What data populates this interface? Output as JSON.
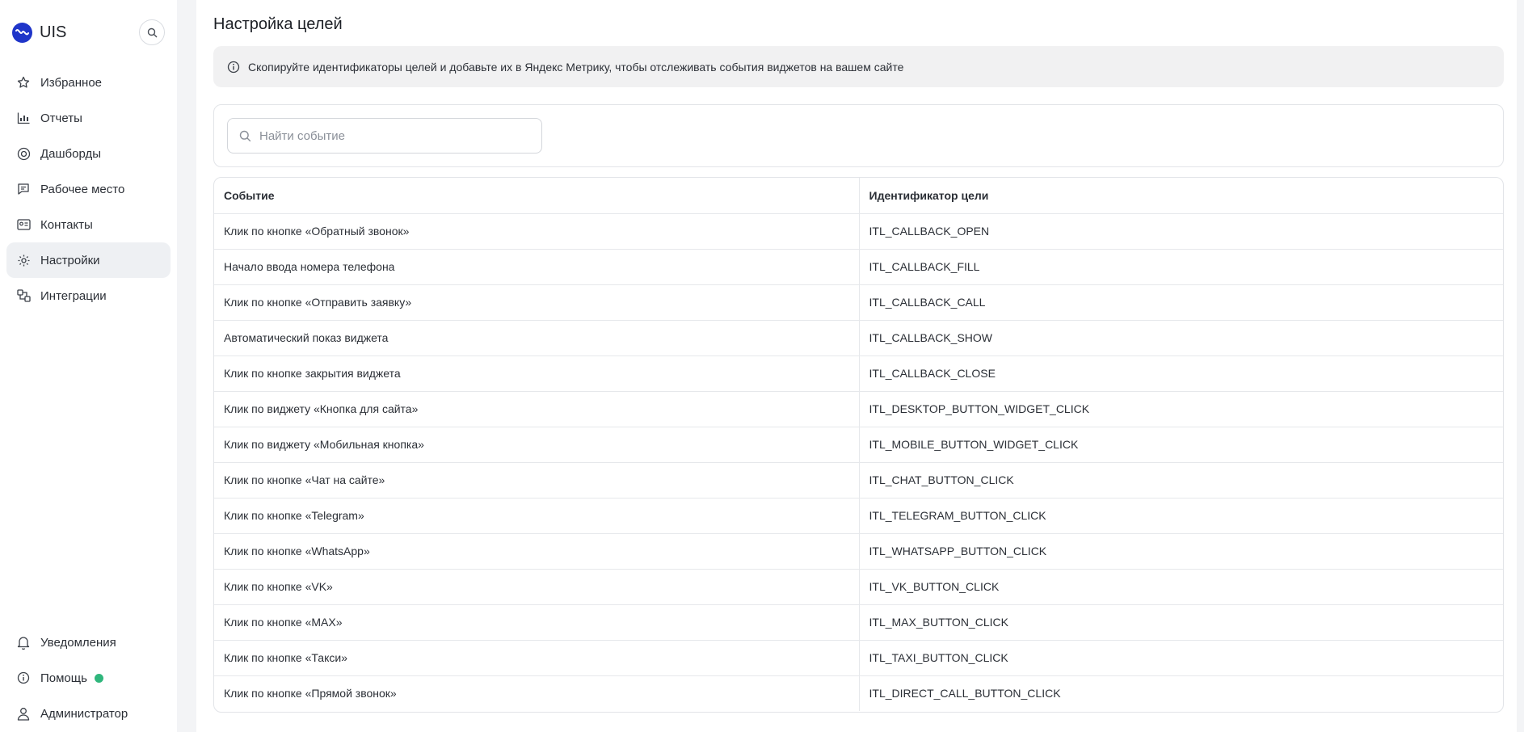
{
  "brand": {
    "name": "UIS"
  },
  "sidebar": {
    "items": [
      {
        "label": "Избранное",
        "icon": "star-icon"
      },
      {
        "label": "Отчеты",
        "icon": "chart-icon"
      },
      {
        "label": "Дашборды",
        "icon": "dashboard-icon"
      },
      {
        "label": "Рабочее место",
        "icon": "workplace-icon"
      },
      {
        "label": "Контакты",
        "icon": "contacts-icon"
      },
      {
        "label": "Настройки",
        "icon": "gear-icon",
        "active": true
      },
      {
        "label": "Интеграции",
        "icon": "integrations-icon"
      }
    ],
    "bottom": [
      {
        "label": "Уведомления",
        "icon": "bell-icon"
      },
      {
        "label": "Помощь",
        "icon": "info-icon",
        "status_color": "#2fb67c"
      },
      {
        "label": "Администратор",
        "icon": "user-icon"
      }
    ]
  },
  "page": {
    "title": "Настройка целей",
    "info": "Скопируйте идентификаторы целей и добавьте их в Яндекс Метрику, чтобы отслеживать события виджетов на вашем сайте"
  },
  "search": {
    "placeholder": "Найти событие",
    "value": ""
  },
  "table": {
    "headers": [
      "Событие",
      "Идентификатор цели"
    ],
    "rows": [
      [
        "Клик по кнопке «Обратный звонок»",
        "ITL_CALLBACK_OPEN"
      ],
      [
        "Начало ввода номера телефона",
        "ITL_CALLBACK_FILL"
      ],
      [
        "Клик по кнопке «Отправить заявку»",
        "ITL_CALLBACK_CALL"
      ],
      [
        "Автоматический показ виджета",
        "ITL_CALLBACK_SHOW"
      ],
      [
        "Клик по кнопке закрытия виджета",
        "ITL_CALLBACK_CLOSE"
      ],
      [
        "Клик по виджету «Кнопка для сайта»",
        "ITL_DESKTOP_BUTTON_WIDGET_CLICK"
      ],
      [
        "Клик по виджету «Мобильная кнопка»",
        "ITL_MOBILE_BUTTON_WIDGET_CLICK"
      ],
      [
        "Клик по кнопке «Чат на сайте»",
        "ITL_CHAT_BUTTON_CLICK"
      ],
      [
        "Клик по кнопке «Telegram»",
        "ITL_TELEGRAM_BUTTON_CLICK"
      ],
      [
        "Клик по кнопке «WhatsApp»",
        "ITL_WHATSAPP_BUTTON_CLICK"
      ],
      [
        "Клик по кнопке «VK»",
        "ITL_VK_BUTTON_CLICK"
      ],
      [
        "Клик по кнопке «MAX»",
        "ITL_MAX_BUTTON_CLICK"
      ],
      [
        "Клик по кнопке «Такси»",
        "ITL_TAXI_BUTTON_CLICK"
      ],
      [
        "Клик по кнопке «Прямой звонок»",
        "ITL_DIRECT_CALL_BUTTON_CLICK"
      ]
    ]
  },
  "colors": {
    "brand": "#1f35c9",
    "active_bg": "#eef0f3",
    "status_online": "#2fb67c"
  }
}
